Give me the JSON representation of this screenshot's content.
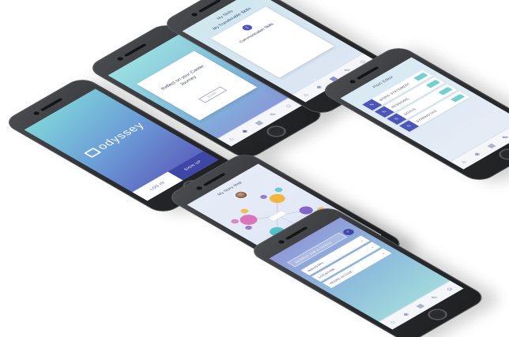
{
  "phone_login": {
    "brand": "odyssey",
    "tagline": "",
    "login_label": "LOG IN",
    "signup_label": "SIGN UP"
  },
  "phone_reflect": {
    "prompt": "Reflect on your Career Journey",
    "start_label": "START"
  },
  "phone_skills": {
    "title": "My Skills",
    "subtitle": "My Transferable Skills",
    "badge": "1",
    "skill_name": "Communication Skills",
    "skill_desc": ""
  },
  "phone_pitch": {
    "title": "Pitch Editor",
    "rows": [
      {
        "label": "WORD STATEMENT",
        "on": true
      },
      {
        "label": "PASSIONS",
        "on": true
      },
      {
        "label": "GOALS",
        "on": true
      },
      {
        "label": "STRENGTHS",
        "on": true
      }
    ]
  },
  "phone_storymap": {
    "title": "My Story Map",
    "caption": "",
    "node_colors": [
      "#d96fb8",
      "#f2b233",
      "#49c1c8",
      "#7d5fc7",
      "#5ec7a0"
    ]
  },
  "phone_search": {
    "search_placeholder": "SEARCH JOB & COACH",
    "filters": [
      {
        "label": "INDUSTRY"
      },
      {
        "label": "LOCATION"
      },
      {
        "label": "YEARS ACTIVE"
      }
    ]
  },
  "tab_icons": [
    "home-icon",
    "map-icon",
    "grid-icon",
    "pencil-icon",
    "profile-icon"
  ],
  "colors": {
    "accent": "#4c55b8",
    "teal": "#74cfcf"
  }
}
